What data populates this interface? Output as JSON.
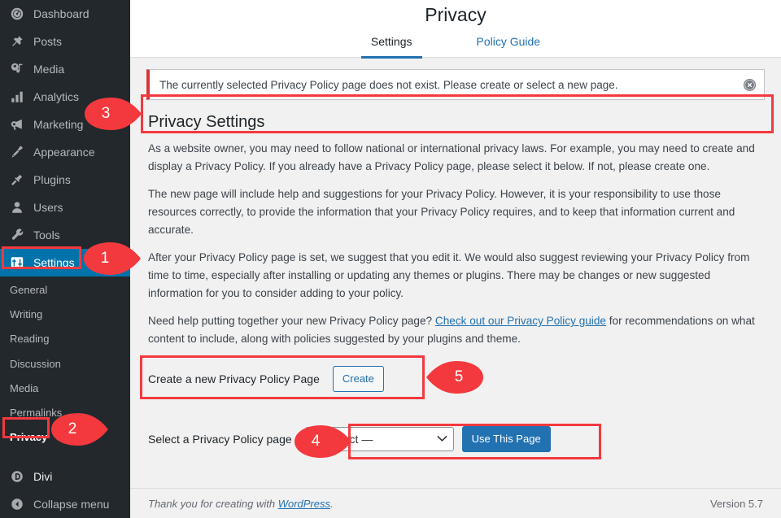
{
  "sidebar": {
    "items": [
      {
        "label": "Dashboard",
        "icon": "dashboard-icon",
        "name": "sidebar-item-dashboard"
      },
      {
        "label": "Posts",
        "icon": "pin-icon",
        "name": "sidebar-item-posts"
      },
      {
        "label": "Media",
        "icon": "media-icon",
        "name": "sidebar-item-media"
      },
      {
        "label": "Analytics",
        "icon": "bar-chart-icon",
        "name": "sidebar-item-analytics"
      },
      {
        "label": "Marketing",
        "icon": "megaphone-icon",
        "name": "sidebar-item-marketing"
      },
      {
        "label": "Appearance",
        "icon": "paintbrush-icon",
        "name": "sidebar-item-appearance"
      },
      {
        "label": "Plugins",
        "icon": "plug-icon",
        "name": "sidebar-item-plugins"
      },
      {
        "label": "Users",
        "icon": "user-icon",
        "name": "sidebar-item-users"
      },
      {
        "label": "Tools",
        "icon": "wrench-icon",
        "name": "sidebar-item-tools"
      },
      {
        "label": "Settings",
        "icon": "sliders-icon",
        "name": "sidebar-item-settings",
        "current": true
      }
    ],
    "submenu": [
      {
        "label": "General"
      },
      {
        "label": "Writing"
      },
      {
        "label": "Reading"
      },
      {
        "label": "Discussion"
      },
      {
        "label": "Media"
      },
      {
        "label": "Permalinks"
      },
      {
        "label": "Privacy",
        "current": true
      }
    ],
    "footer_items": [
      {
        "label": "Divi",
        "icon": "divi-icon",
        "name": "sidebar-item-divi"
      },
      {
        "label": "Collapse menu",
        "icon": "collapse-arrow-icon",
        "name": "sidebar-collapse-menu"
      }
    ],
    "active_color": "#0073aa"
  },
  "header": {
    "title": "Privacy",
    "tabs": [
      {
        "label": "Settings",
        "active": true
      },
      {
        "label": "Policy Guide",
        "active": false
      }
    ]
  },
  "notice": {
    "message": "The currently selected Privacy Policy page does not exist. Please create or select a new page.",
    "dismiss_icon": "dismiss-circle-icon",
    "accent_color": "#d63638"
  },
  "main": {
    "section_title": "Privacy Settings",
    "paragraph1": "As a website owner, you may need to follow national or international privacy laws. For example, you may need to create and display a Privacy Policy. If you already have a Privacy Policy page, please select it below. If not, please create one.",
    "paragraph2": "The new page will include help and suggestions for your Privacy Policy. However, it is your responsibility to use those resources correctly, to provide the information that your Privacy Policy requires, and to keep that information current and accurate.",
    "paragraph3": "After your Privacy Policy page is set, we suggest that you edit it. We would also suggest reviewing your Privacy Policy from time to time, especially after installing or updating any themes or plugins. There may be changes or new suggested information for you to consider adding to your policy.",
    "paragraph4_before": "Need help putting together your new Privacy Policy page? ",
    "paragraph4_link": "Check out our Privacy Policy guide",
    "paragraph4_after": " for recommendations on what content to include, along with policies suggested by your plugins and theme.",
    "create_label": "Create a new Privacy Policy Page",
    "create_button": "Create",
    "select_label": "Select a Privacy Policy page",
    "select_value": "— Select —",
    "select_options": [
      "— Select —"
    ],
    "use_page_button": "Use This Page"
  },
  "footer": {
    "thanks_before": "Thank you for creating with ",
    "thanks_link": "WordPress",
    "thanks_after": ".",
    "version": "Version 5.7"
  },
  "annotations": {
    "callouts": [
      {
        "number": "1",
        "target": "settings-menu-item"
      },
      {
        "number": "2",
        "target": "privacy-submenu-item"
      },
      {
        "number": "3",
        "target": "notice-banner"
      },
      {
        "number": "4",
        "target": "privacy-page-select"
      },
      {
        "number": "5",
        "target": "create-page-row"
      }
    ],
    "color": "#f4393e"
  }
}
